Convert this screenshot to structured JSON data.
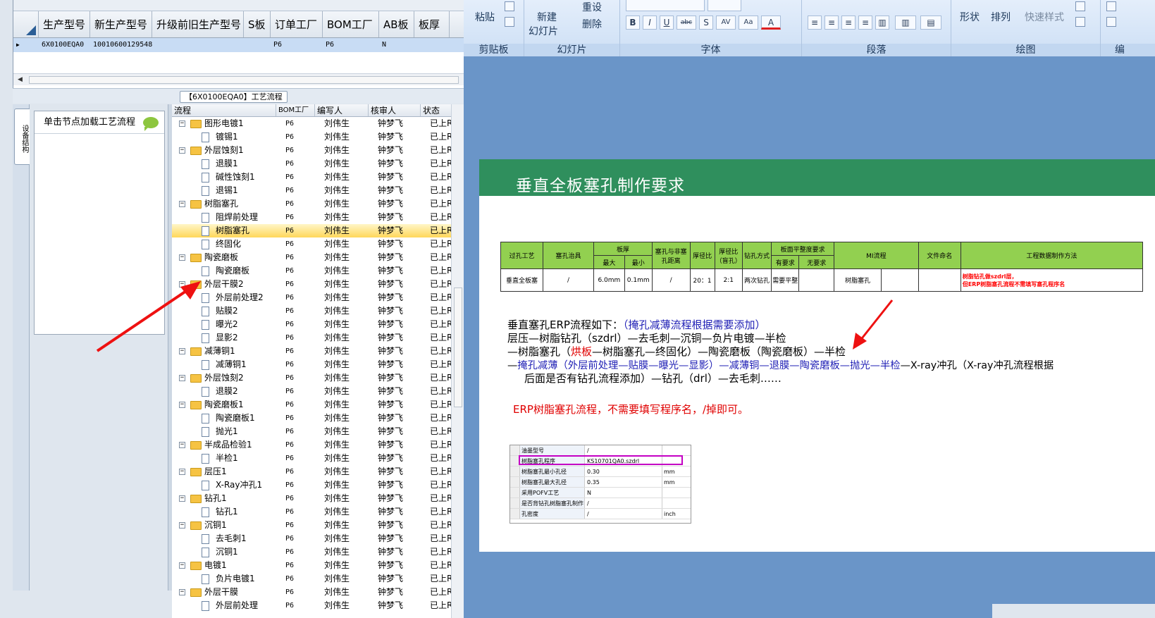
{
  "top_grid": {
    "columns": [
      "生产型号",
      "新生产型号",
      "升级前旧生产型号",
      "S板",
      "订单工厂",
      "BOM工厂",
      "AB板",
      "板厚"
    ],
    "row": [
      "6X0100EQA0",
      "10010600129548",
      "",
      "",
      "P6",
      "P6",
      "N",
      ""
    ]
  },
  "flow_title": "【6X0100EQA0】工艺流程",
  "side_tab": "设备结构",
  "node_panel": {
    "header": "单击节点加载工艺流程"
  },
  "tree": {
    "columns": [
      "流程",
      "BOM工厂",
      "编写人",
      "核审人",
      "状态"
    ],
    "rows": [
      {
        "name": "图形电镀1",
        "level": 0,
        "bom": "P6",
        "writer": "刘伟生",
        "reviewer": "钟梦飞",
        "status": "已上R"
      },
      {
        "name": "镀锡1",
        "level": 1,
        "bom": "P6",
        "writer": "刘伟生",
        "reviewer": "钟梦飞",
        "status": "已上R"
      },
      {
        "name": "外层蚀刻1",
        "level": 0,
        "bom": "P6",
        "writer": "刘伟生",
        "reviewer": "钟梦飞",
        "status": "已上R"
      },
      {
        "name": "退膜1",
        "level": 1,
        "bom": "P6",
        "writer": "刘伟生",
        "reviewer": "钟梦飞",
        "status": "已上R"
      },
      {
        "name": "碱性蚀刻1",
        "level": 1,
        "bom": "P6",
        "writer": "刘伟生",
        "reviewer": "钟梦飞",
        "status": "已上R"
      },
      {
        "name": "退锡1",
        "level": 1,
        "bom": "P6",
        "writer": "刘伟生",
        "reviewer": "钟梦飞",
        "status": "已上R"
      },
      {
        "name": "树脂塞孔",
        "level": 0,
        "bom": "P6",
        "writer": "刘伟生",
        "reviewer": "钟梦飞",
        "status": "已上R"
      },
      {
        "name": "阻焊前处理",
        "level": 1,
        "bom": "P6",
        "writer": "刘伟生",
        "reviewer": "钟梦飞",
        "status": "已上R"
      },
      {
        "name": "树脂塞孔",
        "level": 1,
        "bom": "P6",
        "writer": "刘伟生",
        "reviewer": "钟梦飞",
        "status": "已上R",
        "selected": true
      },
      {
        "name": "终固化",
        "level": 1,
        "bom": "P6",
        "writer": "刘伟生",
        "reviewer": "钟梦飞",
        "status": "已上R"
      },
      {
        "name": "陶瓷磨板",
        "level": 0,
        "bom": "P6",
        "writer": "刘伟生",
        "reviewer": "钟梦飞",
        "status": "已上R"
      },
      {
        "name": "陶瓷磨板",
        "level": 1,
        "bom": "P6",
        "writer": "刘伟生",
        "reviewer": "钟梦飞",
        "status": "已上R"
      },
      {
        "name": "外层干膜2",
        "level": 0,
        "bom": "P6",
        "writer": "刘伟生",
        "reviewer": "钟梦飞",
        "status": "已上R"
      },
      {
        "name": "外层前处理2",
        "level": 1,
        "bom": "P6",
        "writer": "刘伟生",
        "reviewer": "钟梦飞",
        "status": "已上R"
      },
      {
        "name": "贴膜2",
        "level": 1,
        "bom": "P6",
        "writer": "刘伟生",
        "reviewer": "钟梦飞",
        "status": "已上R"
      },
      {
        "name": "曝光2",
        "level": 1,
        "bom": "P6",
        "writer": "刘伟生",
        "reviewer": "钟梦飞",
        "status": "已上R"
      },
      {
        "name": "显影2",
        "level": 1,
        "bom": "P6",
        "writer": "刘伟生",
        "reviewer": "钟梦飞",
        "status": "已上R"
      },
      {
        "name": "减薄铜1",
        "level": 0,
        "bom": "P6",
        "writer": "刘伟生",
        "reviewer": "钟梦飞",
        "status": "已上R"
      },
      {
        "name": "减薄铜1",
        "level": 1,
        "bom": "P6",
        "writer": "刘伟生",
        "reviewer": "钟梦飞",
        "status": "已上R"
      },
      {
        "name": "外层蚀刻2",
        "level": 0,
        "bom": "P6",
        "writer": "刘伟生",
        "reviewer": "钟梦飞",
        "status": "已上R"
      },
      {
        "name": "退膜2",
        "level": 1,
        "bom": "P6",
        "writer": "刘伟生",
        "reviewer": "钟梦飞",
        "status": "已上R"
      },
      {
        "name": "陶瓷磨板1",
        "level": 0,
        "bom": "P6",
        "writer": "刘伟生",
        "reviewer": "钟梦飞",
        "status": "已上R"
      },
      {
        "name": "陶瓷磨板1",
        "level": 1,
        "bom": "P6",
        "writer": "刘伟生",
        "reviewer": "钟梦飞",
        "status": "已上R"
      },
      {
        "name": "抛光1",
        "level": 1,
        "bom": "P6",
        "writer": "刘伟生",
        "reviewer": "钟梦飞",
        "status": "已上R"
      },
      {
        "name": "半成品检验1",
        "level": 0,
        "bom": "P6",
        "writer": "刘伟生",
        "reviewer": "钟梦飞",
        "status": "已上R"
      },
      {
        "name": "半检1",
        "level": 1,
        "bom": "P6",
        "writer": "刘伟生",
        "reviewer": "钟梦飞",
        "status": "已上R"
      },
      {
        "name": "层压1",
        "level": 0,
        "bom": "P6",
        "writer": "刘伟生",
        "reviewer": "钟梦飞",
        "status": "已上R"
      },
      {
        "name": "X-Ray冲孔1",
        "level": 1,
        "bom": "P6",
        "writer": "刘伟生",
        "reviewer": "钟梦飞",
        "status": "已上R"
      },
      {
        "name": "钻孔1",
        "level": 0,
        "bom": "P6",
        "writer": "刘伟生",
        "reviewer": "钟梦飞",
        "status": "已上R"
      },
      {
        "name": "钻孔1",
        "level": 1,
        "bom": "P6",
        "writer": "刘伟生",
        "reviewer": "钟梦飞",
        "status": "已上R"
      },
      {
        "name": "沉铜1",
        "level": 0,
        "bom": "P6",
        "writer": "刘伟生",
        "reviewer": "钟梦飞",
        "status": "已上R"
      },
      {
        "name": "去毛刺1",
        "level": 1,
        "bom": "P6",
        "writer": "刘伟生",
        "reviewer": "钟梦飞",
        "status": "已上R"
      },
      {
        "name": "沉铜1",
        "level": 1,
        "bom": "P6",
        "writer": "刘伟生",
        "reviewer": "钟梦飞",
        "status": "已上R"
      },
      {
        "name": "电镀1",
        "level": 0,
        "bom": "P6",
        "writer": "刘伟生",
        "reviewer": "钟梦飞",
        "status": "已上R"
      },
      {
        "name": "负片电镀1",
        "level": 1,
        "bom": "P6",
        "writer": "刘伟生",
        "reviewer": "钟梦飞",
        "status": "已上R"
      },
      {
        "name": "外层干膜",
        "level": 0,
        "bom": "P6",
        "writer": "刘伟生",
        "reviewer": "钟梦飞",
        "status": "已上R"
      },
      {
        "name": "外层前处理",
        "level": 1,
        "bom": "P6",
        "writer": "刘伟生",
        "reviewer": "钟梦飞",
        "status": "已上R"
      }
    ]
  },
  "ribbon": {
    "paste": "粘贴",
    "new_slide": "新建",
    "new_slide2": "幻灯片",
    "reset": "重设",
    "delete": "删除",
    "shape": "形状",
    "arrange": "排列",
    "quick_style": "快速样式",
    "groups": [
      "剪贴板",
      "幻灯片",
      "字体",
      "段落",
      "绘图",
      "编"
    ],
    "font_buttons": [
      "B",
      "I",
      "U",
      "abc",
      "S",
      "AV",
      "Aa",
      "A"
    ]
  },
  "slide": {
    "title": "垂直全板塞孔制作要求",
    "table": {
      "h1": [
        "过孔工艺",
        "塞孔治具",
        "板厚",
        "塞孔与非塞孔距离",
        "厚径比",
        "厚径比（盲孔）",
        "钻孔方式",
        "板面平整度要求",
        "MI流程",
        "文件命名",
        "工程数据制作方法"
      ],
      "h2": [
        "最大",
        "最小",
        "有要求",
        "无要求"
      ],
      "row": [
        "垂直全板塞",
        "/",
        "6.0mm",
        "0.1mm",
        "/",
        "20：1",
        "2:1",
        "两次钻孔",
        "需要平整",
        "",
        "树脂塞孔",
        "",
        "",
        ""
      ],
      "note1": "树脂钻孔做szdrl层，",
      "note2": "但ERP树脂塞孔流程不需填写塞孔程序名"
    },
    "p1a": "垂直塞孔ERP流程如下：",
    "p1b": "（掩孔减薄流程根据需要添加）",
    "p2": "层压—树脂钻孔（szdrl）—去毛刺—沉铜—负片电镀—半检",
    "p3a": "—树脂塞孔（",
    "p3b": "烘板",
    "p3c": "—树脂塞孔—终固化）—陶瓷磨板（陶瓷磨板）—半检",
    "p4a": "—",
    "p4b": "掩孔减薄（外层前处理—贴膜—曝光—显影）—减薄铜—退膜—陶瓷磨板—抛光—半检",
    "p4c": "—X-ray冲孔（X-ray冲孔流程根据",
    "p5": "后面是否有钻孔流程添加）—钻孔（drl）—去毛刺……",
    "p6": "ERP树脂塞孔流程，不需要填写程序名，/掉即可。",
    "shot_rows": [
      [
        "油墨型号",
        "/",
        ""
      ],
      [
        "树脂塞孔程序",
        "KS10701QA0.szdrl",
        ""
      ],
      [
        "树脂塞孔最小孔径",
        "0.30",
        "mm"
      ],
      [
        "树脂塞孔最大孔径",
        "0.35",
        "mm"
      ],
      [
        "采用POFV工艺",
        "N",
        ""
      ],
      [
        "是否背钻孔树脂塞孔制作",
        "/",
        ""
      ],
      [
        "孔密度",
        "/",
        "inch"
      ]
    ]
  }
}
